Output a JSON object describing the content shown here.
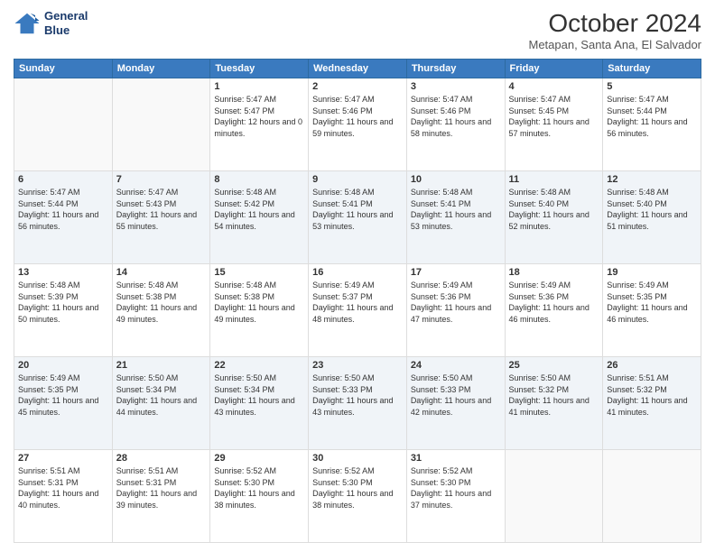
{
  "header": {
    "logo_line1": "General",
    "logo_line2": "Blue",
    "month": "October 2024",
    "location": "Metapan, Santa Ana, El Salvador"
  },
  "weekdays": [
    "Sunday",
    "Monday",
    "Tuesday",
    "Wednesday",
    "Thursday",
    "Friday",
    "Saturday"
  ],
  "weeks": [
    [
      {
        "day": "",
        "sunrise": "",
        "sunset": "",
        "daylight": ""
      },
      {
        "day": "",
        "sunrise": "",
        "sunset": "",
        "daylight": ""
      },
      {
        "day": "1",
        "sunrise": "Sunrise: 5:47 AM",
        "sunset": "Sunset: 5:47 PM",
        "daylight": "Daylight: 12 hours and 0 minutes."
      },
      {
        "day": "2",
        "sunrise": "Sunrise: 5:47 AM",
        "sunset": "Sunset: 5:46 PM",
        "daylight": "Daylight: 11 hours and 59 minutes."
      },
      {
        "day": "3",
        "sunrise": "Sunrise: 5:47 AM",
        "sunset": "Sunset: 5:46 PM",
        "daylight": "Daylight: 11 hours and 58 minutes."
      },
      {
        "day": "4",
        "sunrise": "Sunrise: 5:47 AM",
        "sunset": "Sunset: 5:45 PM",
        "daylight": "Daylight: 11 hours and 57 minutes."
      },
      {
        "day": "5",
        "sunrise": "Sunrise: 5:47 AM",
        "sunset": "Sunset: 5:44 PM",
        "daylight": "Daylight: 11 hours and 56 minutes."
      }
    ],
    [
      {
        "day": "6",
        "sunrise": "Sunrise: 5:47 AM",
        "sunset": "Sunset: 5:44 PM",
        "daylight": "Daylight: 11 hours and 56 minutes."
      },
      {
        "day": "7",
        "sunrise": "Sunrise: 5:47 AM",
        "sunset": "Sunset: 5:43 PM",
        "daylight": "Daylight: 11 hours and 55 minutes."
      },
      {
        "day": "8",
        "sunrise": "Sunrise: 5:48 AM",
        "sunset": "Sunset: 5:42 PM",
        "daylight": "Daylight: 11 hours and 54 minutes."
      },
      {
        "day": "9",
        "sunrise": "Sunrise: 5:48 AM",
        "sunset": "Sunset: 5:41 PM",
        "daylight": "Daylight: 11 hours and 53 minutes."
      },
      {
        "day": "10",
        "sunrise": "Sunrise: 5:48 AM",
        "sunset": "Sunset: 5:41 PM",
        "daylight": "Daylight: 11 hours and 53 minutes."
      },
      {
        "day": "11",
        "sunrise": "Sunrise: 5:48 AM",
        "sunset": "Sunset: 5:40 PM",
        "daylight": "Daylight: 11 hours and 52 minutes."
      },
      {
        "day": "12",
        "sunrise": "Sunrise: 5:48 AM",
        "sunset": "Sunset: 5:40 PM",
        "daylight": "Daylight: 11 hours and 51 minutes."
      }
    ],
    [
      {
        "day": "13",
        "sunrise": "Sunrise: 5:48 AM",
        "sunset": "Sunset: 5:39 PM",
        "daylight": "Daylight: 11 hours and 50 minutes."
      },
      {
        "day": "14",
        "sunrise": "Sunrise: 5:48 AM",
        "sunset": "Sunset: 5:38 PM",
        "daylight": "Daylight: 11 hours and 49 minutes."
      },
      {
        "day": "15",
        "sunrise": "Sunrise: 5:48 AM",
        "sunset": "Sunset: 5:38 PM",
        "daylight": "Daylight: 11 hours and 49 minutes."
      },
      {
        "day": "16",
        "sunrise": "Sunrise: 5:49 AM",
        "sunset": "Sunset: 5:37 PM",
        "daylight": "Daylight: 11 hours and 48 minutes."
      },
      {
        "day": "17",
        "sunrise": "Sunrise: 5:49 AM",
        "sunset": "Sunset: 5:36 PM",
        "daylight": "Daylight: 11 hours and 47 minutes."
      },
      {
        "day": "18",
        "sunrise": "Sunrise: 5:49 AM",
        "sunset": "Sunset: 5:36 PM",
        "daylight": "Daylight: 11 hours and 46 minutes."
      },
      {
        "day": "19",
        "sunrise": "Sunrise: 5:49 AM",
        "sunset": "Sunset: 5:35 PM",
        "daylight": "Daylight: 11 hours and 46 minutes."
      }
    ],
    [
      {
        "day": "20",
        "sunrise": "Sunrise: 5:49 AM",
        "sunset": "Sunset: 5:35 PM",
        "daylight": "Daylight: 11 hours and 45 minutes."
      },
      {
        "day": "21",
        "sunrise": "Sunrise: 5:50 AM",
        "sunset": "Sunset: 5:34 PM",
        "daylight": "Daylight: 11 hours and 44 minutes."
      },
      {
        "day": "22",
        "sunrise": "Sunrise: 5:50 AM",
        "sunset": "Sunset: 5:34 PM",
        "daylight": "Daylight: 11 hours and 43 minutes."
      },
      {
        "day": "23",
        "sunrise": "Sunrise: 5:50 AM",
        "sunset": "Sunset: 5:33 PM",
        "daylight": "Daylight: 11 hours and 43 minutes."
      },
      {
        "day": "24",
        "sunrise": "Sunrise: 5:50 AM",
        "sunset": "Sunset: 5:33 PM",
        "daylight": "Daylight: 11 hours and 42 minutes."
      },
      {
        "day": "25",
        "sunrise": "Sunrise: 5:50 AM",
        "sunset": "Sunset: 5:32 PM",
        "daylight": "Daylight: 11 hours and 41 minutes."
      },
      {
        "day": "26",
        "sunrise": "Sunrise: 5:51 AM",
        "sunset": "Sunset: 5:32 PM",
        "daylight": "Daylight: 11 hours and 41 minutes."
      }
    ],
    [
      {
        "day": "27",
        "sunrise": "Sunrise: 5:51 AM",
        "sunset": "Sunset: 5:31 PM",
        "daylight": "Daylight: 11 hours and 40 minutes."
      },
      {
        "day": "28",
        "sunrise": "Sunrise: 5:51 AM",
        "sunset": "Sunset: 5:31 PM",
        "daylight": "Daylight: 11 hours and 39 minutes."
      },
      {
        "day": "29",
        "sunrise": "Sunrise: 5:52 AM",
        "sunset": "Sunset: 5:30 PM",
        "daylight": "Daylight: 11 hours and 38 minutes."
      },
      {
        "day": "30",
        "sunrise": "Sunrise: 5:52 AM",
        "sunset": "Sunset: 5:30 PM",
        "daylight": "Daylight: 11 hours and 38 minutes."
      },
      {
        "day": "31",
        "sunrise": "Sunrise: 5:52 AM",
        "sunset": "Sunset: 5:30 PM",
        "daylight": "Daylight: 11 hours and 37 minutes."
      },
      {
        "day": "",
        "sunrise": "",
        "sunset": "",
        "daylight": ""
      },
      {
        "day": "",
        "sunrise": "",
        "sunset": "",
        "daylight": ""
      }
    ]
  ]
}
